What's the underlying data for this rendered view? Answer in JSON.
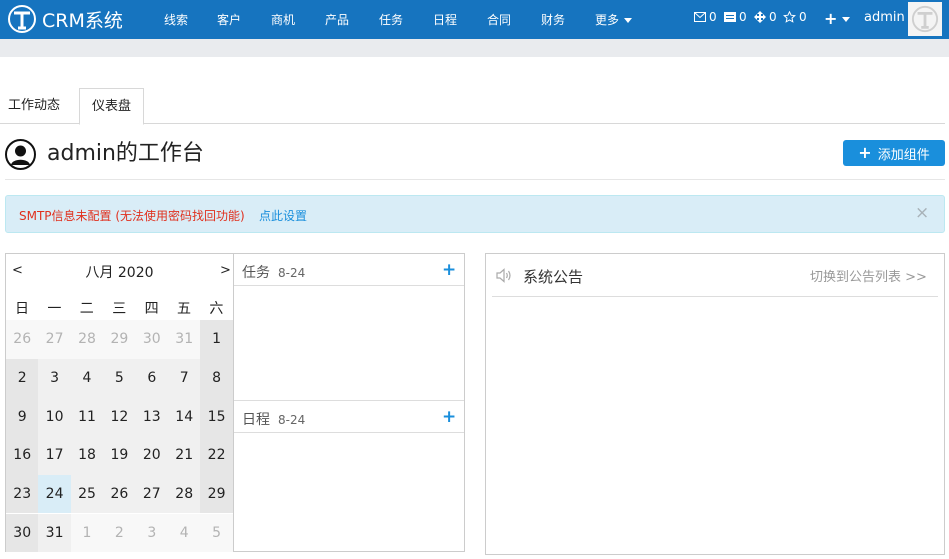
{
  "brand": {
    "logo_text": "CRM系统"
  },
  "nav": {
    "items": [
      "线索",
      "客户",
      "商机",
      "产品",
      "任务",
      "日程",
      "合同",
      "财务"
    ],
    "more_label": "更多"
  },
  "counters": [
    {
      "icon": "mail-icon",
      "value": "0"
    },
    {
      "icon": "card-icon",
      "value": "0"
    },
    {
      "icon": "move-icon",
      "value": "0"
    },
    {
      "icon": "star-icon",
      "value": "0"
    }
  ],
  "user": {
    "name": "admin",
    "plus_label": "+"
  },
  "tabs": [
    {
      "label": "工作动态",
      "active": false
    },
    {
      "label": "仪表盘",
      "active": true
    }
  ],
  "page": {
    "title": "admin的工作台",
    "add_widget_label": "添加组件"
  },
  "alert": {
    "message": "SMTP信息未配置 (无法使用密码找回功能)",
    "link": "点此设置",
    "close": "×"
  },
  "calendar": {
    "title": "八月 2020",
    "prev": "<",
    "next": ">",
    "weekdays": [
      "日",
      "一",
      "二",
      "三",
      "四",
      "五",
      "六"
    ],
    "weeks": [
      [
        "26",
        "27",
        "28",
        "29",
        "30",
        "31",
        "1"
      ],
      [
        "2",
        "3",
        "4",
        "5",
        "6",
        "7",
        "8"
      ],
      [
        "9",
        "10",
        "11",
        "12",
        "13",
        "14",
        "15"
      ],
      [
        "16",
        "17",
        "18",
        "19",
        "20",
        "21",
        "22"
      ],
      [
        "23",
        "24",
        "25",
        "26",
        "27",
        "28",
        "29"
      ],
      [
        "30",
        "31",
        "1",
        "2",
        "3",
        "4",
        "5"
      ]
    ],
    "today": "24"
  },
  "tasks": {
    "title": "任务",
    "date": "8-24",
    "add": "+"
  },
  "schedule": {
    "title": "日程",
    "date": "8-24",
    "add": "+"
  },
  "notice": {
    "title": "系统公告",
    "link": "切换到公告列表 >>"
  },
  "colors": {
    "navbar": "#1674bf",
    "primary": "#1a8fdc",
    "alert_bg": "#d9edf7",
    "alert_text": "#e0301e"
  }
}
